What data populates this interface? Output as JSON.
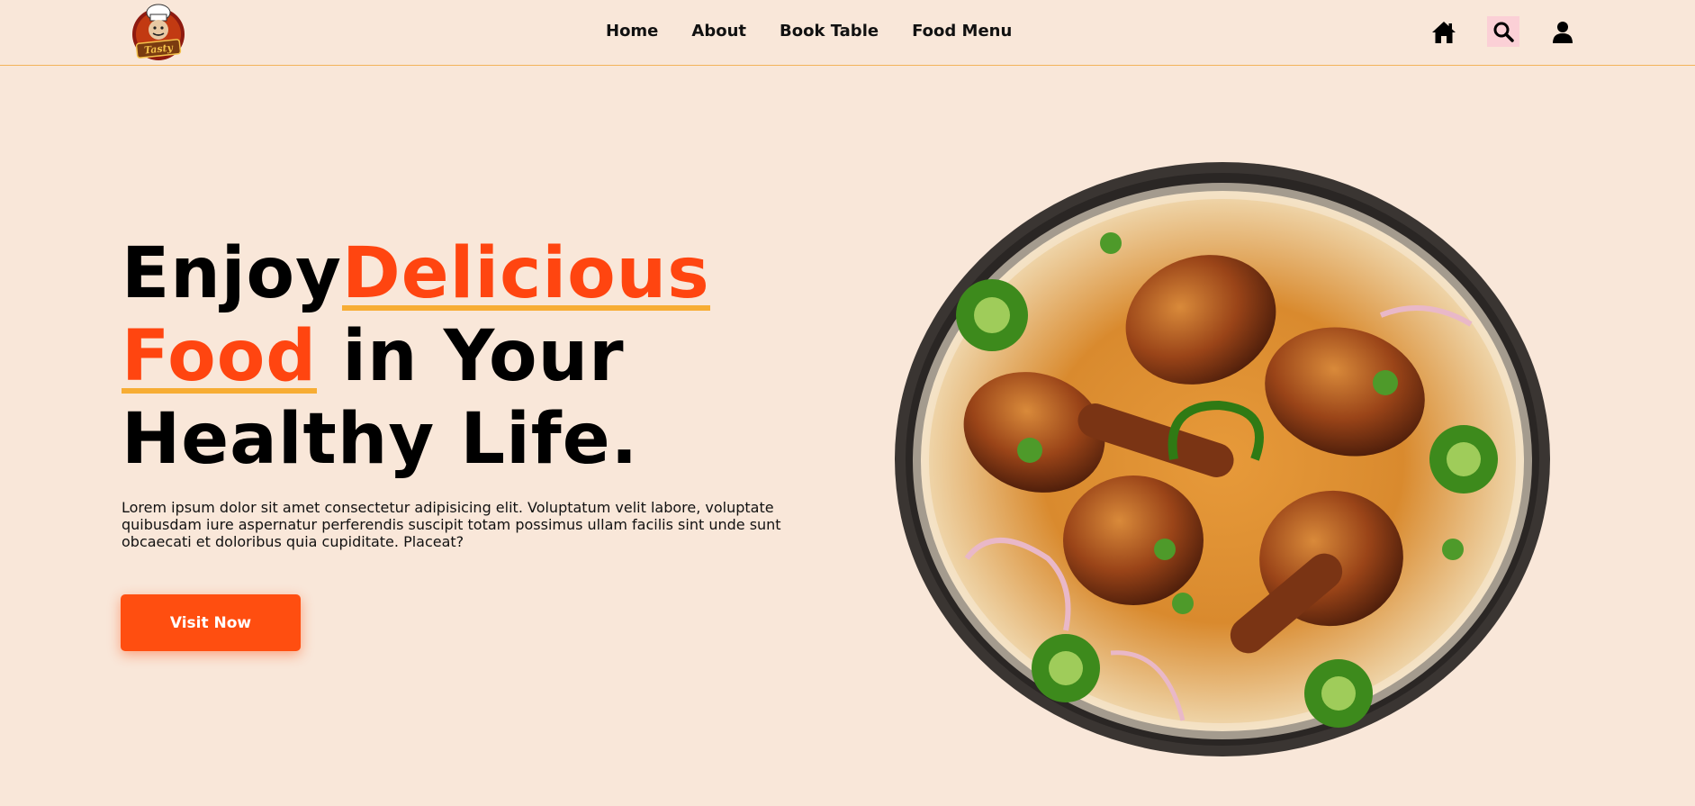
{
  "brand": {
    "logo_text": "Tasty",
    "colors": {
      "background": "#f9e7d9",
      "accent": "#ff4510",
      "underline": "#f7ad34",
      "button": "#ff4e10"
    }
  },
  "nav": {
    "links": [
      "Home",
      "About",
      "Book Table",
      "Food Menu"
    ],
    "icons": [
      "home-icon",
      "search-icon",
      "user-icon"
    ]
  },
  "hero": {
    "title_part1": "Enjoy",
    "title_highlight1": "Delicious",
    "title_highlight2": "Food",
    "title_part2": " in Your",
    "title_line3": "Healthy Life.",
    "description": "Lorem ipsum dolor sit amet consectetur adipisicing elit. Voluptatum velit labore, voluptate quibusdam iure aspernatur perferendis suscipit totam possimus ullam facilis sint unde sunt obcaecati et doloribus quia cupiditate. Placeat?",
    "button_label": "Visit Now"
  }
}
